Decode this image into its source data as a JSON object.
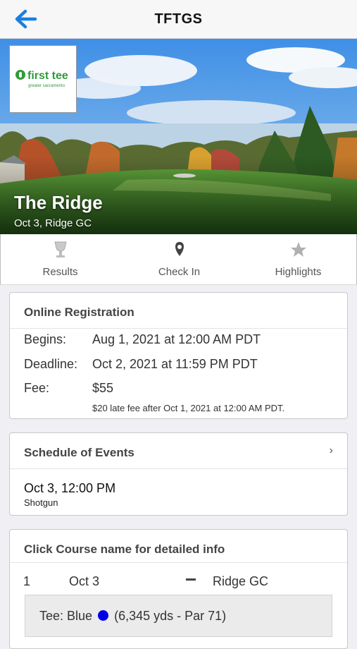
{
  "header": {
    "title": "TFTGS",
    "back_icon": "arrow-left-icon",
    "accent": "#1a7fe0"
  },
  "event": {
    "name": "The Ridge",
    "subtitle": "Oct 3, Ridge GC",
    "logo": {
      "brand": "first tee",
      "sub": "greater sacramento"
    }
  },
  "tabs": [
    {
      "label": "Results",
      "icon": "trophy-icon"
    },
    {
      "label": "Check In",
      "icon": "location-pin-icon"
    },
    {
      "label": "Highlights",
      "icon": "star-icon"
    }
  ],
  "registration": {
    "heading": "Online Registration",
    "rows": [
      {
        "key": "Begins:",
        "value": "Aug 1, 2021 at 12:00 AM PDT"
      },
      {
        "key": "Deadline:",
        "value": "Oct 2, 2021 at 11:59 PM PDT"
      },
      {
        "key": "Fee:",
        "value": "$55"
      }
    ],
    "late_fee_note": "$20 late fee after Oct 1, 2021 at 12:00 AM PDT."
  },
  "schedule": {
    "heading": "Schedule of Events",
    "chevron": "›",
    "time": "Oct 3, 12:00 PM",
    "type": "Shotgun"
  },
  "courses": {
    "heading": "Click Course name for detailed info",
    "rows": [
      {
        "num": "1",
        "date": "Oct 3",
        "course": "Ridge GC"
      }
    ],
    "tee": {
      "label": "Tee: Blue",
      "color": "#0000e6",
      "detail": "(6,345 yds - Par 71)"
    }
  }
}
